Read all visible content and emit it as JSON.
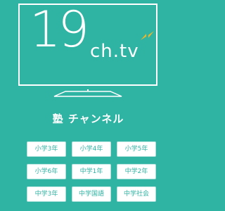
{
  "logo": {
    "number": "19",
    "suffix": "ch.tv"
  },
  "channel_title": "塾 チャンネル",
  "grades": [
    "小学3年",
    "小学4年",
    "小学5年",
    "小学6年",
    "中学1年",
    "中学2年",
    "中学3年",
    "中学国語",
    "中学社会"
  ],
  "colors": {
    "background": "#2fb3a2",
    "accent": "#f0b429",
    "button_text": "#2fb3a2"
  }
}
